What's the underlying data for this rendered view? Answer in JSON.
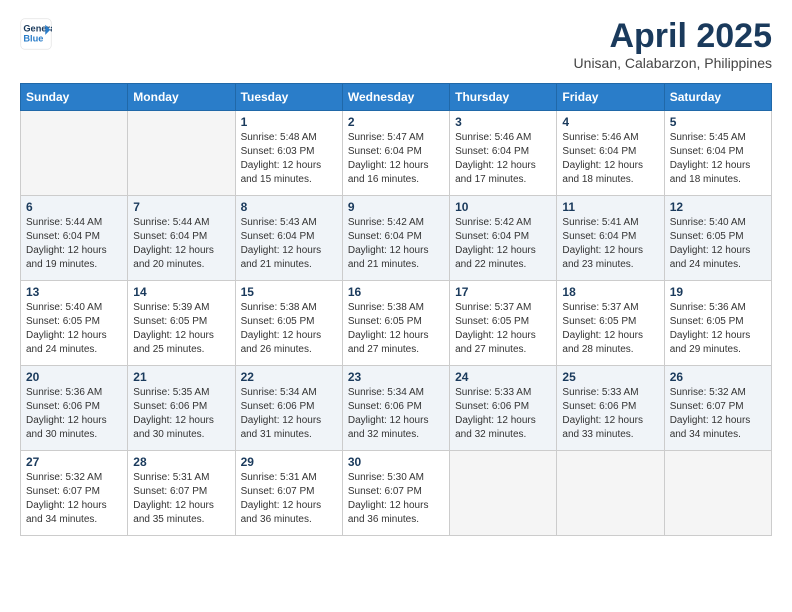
{
  "logo": {
    "line1": "General",
    "line2": "Blue"
  },
  "title": "April 2025",
  "subtitle": "Unisan, Calabarzon, Philippines",
  "weekdays": [
    "Sunday",
    "Monday",
    "Tuesday",
    "Wednesday",
    "Thursday",
    "Friday",
    "Saturday"
  ],
  "weeks": [
    [
      {
        "day": "",
        "info": ""
      },
      {
        "day": "",
        "info": ""
      },
      {
        "day": "1",
        "info": "Sunrise: 5:48 AM\nSunset: 6:03 PM\nDaylight: 12 hours and 15 minutes."
      },
      {
        "day": "2",
        "info": "Sunrise: 5:47 AM\nSunset: 6:04 PM\nDaylight: 12 hours and 16 minutes."
      },
      {
        "day": "3",
        "info": "Sunrise: 5:46 AM\nSunset: 6:04 PM\nDaylight: 12 hours and 17 minutes."
      },
      {
        "day": "4",
        "info": "Sunrise: 5:46 AM\nSunset: 6:04 PM\nDaylight: 12 hours and 18 minutes."
      },
      {
        "day": "5",
        "info": "Sunrise: 5:45 AM\nSunset: 6:04 PM\nDaylight: 12 hours and 18 minutes."
      }
    ],
    [
      {
        "day": "6",
        "info": "Sunrise: 5:44 AM\nSunset: 6:04 PM\nDaylight: 12 hours and 19 minutes."
      },
      {
        "day": "7",
        "info": "Sunrise: 5:44 AM\nSunset: 6:04 PM\nDaylight: 12 hours and 20 minutes."
      },
      {
        "day": "8",
        "info": "Sunrise: 5:43 AM\nSunset: 6:04 PM\nDaylight: 12 hours and 21 minutes."
      },
      {
        "day": "9",
        "info": "Sunrise: 5:42 AM\nSunset: 6:04 PM\nDaylight: 12 hours and 21 minutes."
      },
      {
        "day": "10",
        "info": "Sunrise: 5:42 AM\nSunset: 6:04 PM\nDaylight: 12 hours and 22 minutes."
      },
      {
        "day": "11",
        "info": "Sunrise: 5:41 AM\nSunset: 6:04 PM\nDaylight: 12 hours and 23 minutes."
      },
      {
        "day": "12",
        "info": "Sunrise: 5:40 AM\nSunset: 6:05 PM\nDaylight: 12 hours and 24 minutes."
      }
    ],
    [
      {
        "day": "13",
        "info": "Sunrise: 5:40 AM\nSunset: 6:05 PM\nDaylight: 12 hours and 24 minutes."
      },
      {
        "day": "14",
        "info": "Sunrise: 5:39 AM\nSunset: 6:05 PM\nDaylight: 12 hours and 25 minutes."
      },
      {
        "day": "15",
        "info": "Sunrise: 5:38 AM\nSunset: 6:05 PM\nDaylight: 12 hours and 26 minutes."
      },
      {
        "day": "16",
        "info": "Sunrise: 5:38 AM\nSunset: 6:05 PM\nDaylight: 12 hours and 27 minutes."
      },
      {
        "day": "17",
        "info": "Sunrise: 5:37 AM\nSunset: 6:05 PM\nDaylight: 12 hours and 27 minutes."
      },
      {
        "day": "18",
        "info": "Sunrise: 5:37 AM\nSunset: 6:05 PM\nDaylight: 12 hours and 28 minutes."
      },
      {
        "day": "19",
        "info": "Sunrise: 5:36 AM\nSunset: 6:05 PM\nDaylight: 12 hours and 29 minutes."
      }
    ],
    [
      {
        "day": "20",
        "info": "Sunrise: 5:36 AM\nSunset: 6:06 PM\nDaylight: 12 hours and 30 minutes."
      },
      {
        "day": "21",
        "info": "Sunrise: 5:35 AM\nSunset: 6:06 PM\nDaylight: 12 hours and 30 minutes."
      },
      {
        "day": "22",
        "info": "Sunrise: 5:34 AM\nSunset: 6:06 PM\nDaylight: 12 hours and 31 minutes."
      },
      {
        "day": "23",
        "info": "Sunrise: 5:34 AM\nSunset: 6:06 PM\nDaylight: 12 hours and 32 minutes."
      },
      {
        "day": "24",
        "info": "Sunrise: 5:33 AM\nSunset: 6:06 PM\nDaylight: 12 hours and 32 minutes."
      },
      {
        "day": "25",
        "info": "Sunrise: 5:33 AM\nSunset: 6:06 PM\nDaylight: 12 hours and 33 minutes."
      },
      {
        "day": "26",
        "info": "Sunrise: 5:32 AM\nSunset: 6:07 PM\nDaylight: 12 hours and 34 minutes."
      }
    ],
    [
      {
        "day": "27",
        "info": "Sunrise: 5:32 AM\nSunset: 6:07 PM\nDaylight: 12 hours and 34 minutes."
      },
      {
        "day": "28",
        "info": "Sunrise: 5:31 AM\nSunset: 6:07 PM\nDaylight: 12 hours and 35 minutes."
      },
      {
        "day": "29",
        "info": "Sunrise: 5:31 AM\nSunset: 6:07 PM\nDaylight: 12 hours and 36 minutes."
      },
      {
        "day": "30",
        "info": "Sunrise: 5:30 AM\nSunset: 6:07 PM\nDaylight: 12 hours and 36 minutes."
      },
      {
        "day": "",
        "info": ""
      },
      {
        "day": "",
        "info": ""
      },
      {
        "day": "",
        "info": ""
      }
    ]
  ]
}
